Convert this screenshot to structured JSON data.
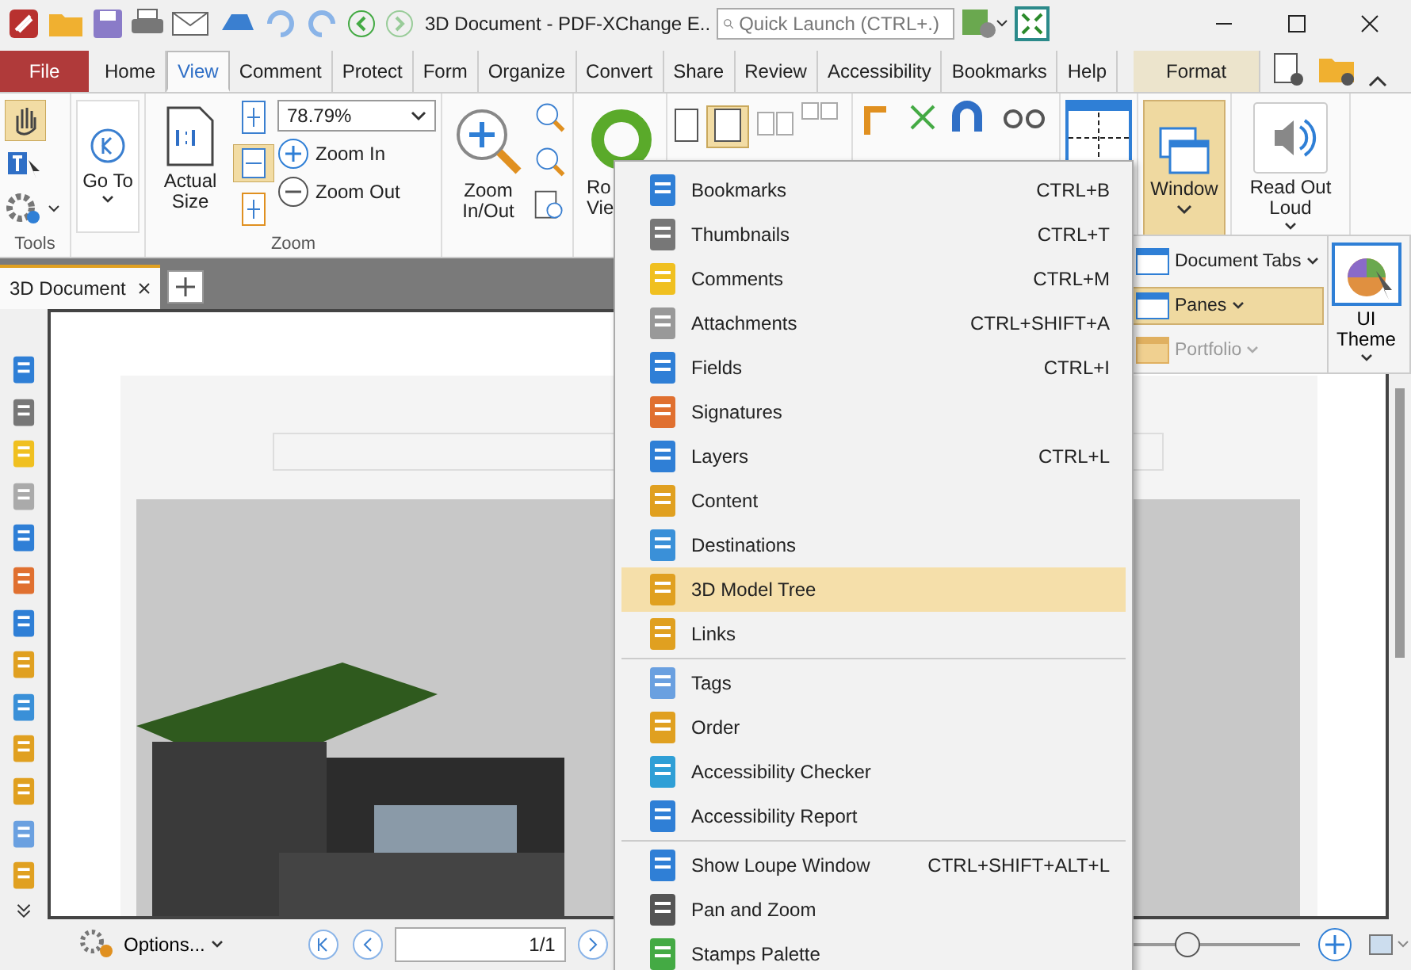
{
  "title_bar": {
    "title": "3D Document - PDF-XChange E..",
    "search": {
      "placeholder": "Quick Launch (CTRL+.)"
    }
  },
  "tabs": [
    {
      "label": "File",
      "kind": "file",
      "selected": false
    },
    {
      "label": "Home",
      "kind": "tab",
      "selected": false
    },
    {
      "label": "View",
      "kind": "tab",
      "selected": true
    },
    {
      "label": "Comment",
      "kind": "tab",
      "selected": false
    },
    {
      "label": "Protect",
      "kind": "tab",
      "selected": false
    },
    {
      "label": "Form",
      "kind": "tab",
      "selected": false
    },
    {
      "label": "Organize",
      "kind": "tab",
      "selected": false
    },
    {
      "label": "Convert",
      "kind": "tab",
      "selected": false
    },
    {
      "label": "Share",
      "kind": "tab",
      "selected": false
    },
    {
      "label": "Review",
      "kind": "tab",
      "selected": false
    },
    {
      "label": "Accessibility",
      "kind": "tab",
      "selected": false
    },
    {
      "label": "Bookmarks",
      "kind": "tab",
      "selected": false
    },
    {
      "label": "Help",
      "kind": "tab",
      "selected": false
    },
    {
      "label": "Format",
      "kind": "context",
      "selected": false
    }
  ],
  "ribbon": {
    "tools_label": "Tools",
    "go_to": "Go To",
    "actual_size": "Actual Size",
    "zoom_value": "78.79%",
    "zoom_in": "Zoom In",
    "zoom_out": "Zoom Out",
    "zoom_label": "Zoom",
    "zoom_in_out": "Zoom In/Out",
    "rotate": "Ro Vie",
    "window": "Window",
    "read_out_loud": "Read Out Loud"
  },
  "window_submenu": {
    "items": [
      {
        "label": "Document Tabs",
        "selected": false,
        "disabled": false
      },
      {
        "label": "Panes",
        "selected": true,
        "disabled": false
      },
      {
        "label": "Portfolio",
        "selected": false,
        "disabled": true
      }
    ],
    "ui_theme": "UI Theme"
  },
  "document_tab": {
    "label": "3D Document"
  },
  "menu": {
    "sections": [
      [
        {
          "label": "Bookmarks",
          "shortcut": "CTRL+B",
          "selected": false
        },
        {
          "label": "Thumbnails",
          "shortcut": "CTRL+T",
          "selected": false
        },
        {
          "label": "Comments",
          "shortcut": "CTRL+M",
          "selected": false
        },
        {
          "label": "Attachments",
          "shortcut": "CTRL+SHIFT+A",
          "selected": false
        },
        {
          "label": "Fields",
          "shortcut": "CTRL+I",
          "selected": false
        },
        {
          "label": "Signatures",
          "selected": false
        },
        {
          "label": "Layers",
          "shortcut": "CTRL+L",
          "selected": false
        },
        {
          "label": "Content",
          "selected": false
        },
        {
          "label": "Destinations",
          "selected": false
        },
        {
          "label": "3D Model Tree",
          "selected": true
        },
        {
          "label": "Links",
          "selected": false
        }
      ],
      [
        {
          "label": "Tags",
          "selected": false
        },
        {
          "label": "Order",
          "selected": false
        },
        {
          "label": "Accessibility Checker",
          "selected": false
        },
        {
          "label": "Accessibility Report",
          "selected": false
        }
      ],
      [
        {
          "label": "Show Loupe Window",
          "shortcut": "CTRL+SHIFT+ALT+L",
          "selected": false
        },
        {
          "label": "Pan and Zoom",
          "selected": false
        },
        {
          "label": "Stamps Palette",
          "selected": false
        }
      ]
    ]
  },
  "status_bar": {
    "options": "Options...",
    "page": "1/1",
    "zoom_slider": {
      "level": 0.35
    }
  }
}
